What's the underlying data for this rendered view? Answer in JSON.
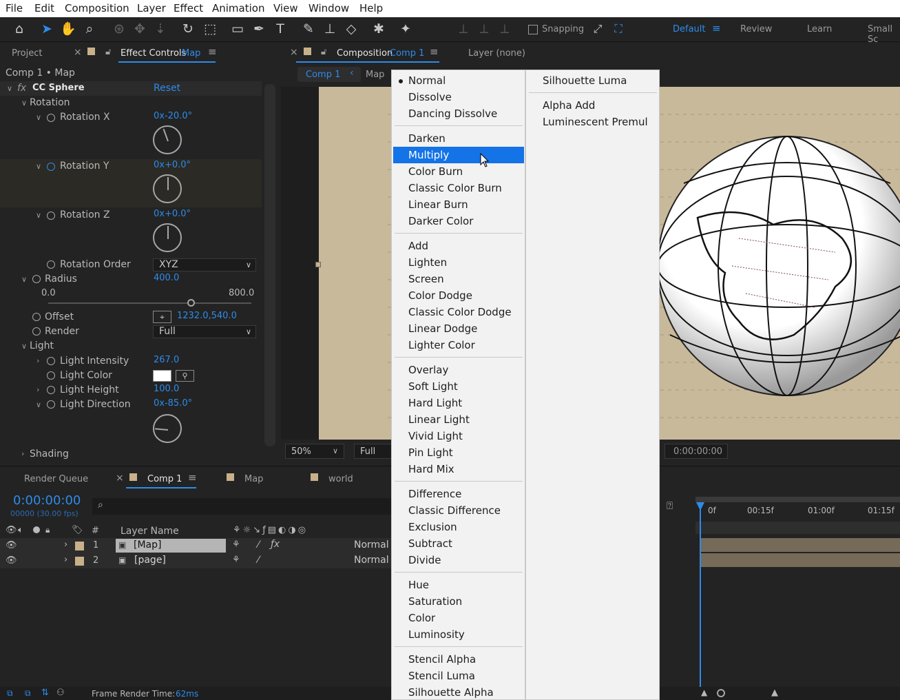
{
  "menubar": {
    "items": [
      "File",
      "Edit",
      "Composition",
      "Layer",
      "Effect",
      "Animation",
      "View",
      "Window",
      "Help"
    ]
  },
  "toolbar": {
    "snapping_label": "Snapping",
    "workspaces": [
      "Default",
      "Review",
      "Learn",
      "Small Sc"
    ],
    "active_workspace": "Default"
  },
  "left_panel": {
    "tab_project": "Project",
    "tab_effect_controls": "Effect Controls",
    "tab_effect_controls_target": "Map",
    "breadcrumb": "Comp 1 • Map",
    "effect_badge": "fx",
    "effect_name": "CC Sphere",
    "reset_label": "Reset",
    "rotation_group": "Rotation",
    "rotation_x_label": "Rotation X",
    "rotation_x_value": "0x-20.0°",
    "rotation_y_label": "Rotation Y",
    "rotation_y_value": "0x+0.0°",
    "rotation_z_label": "Rotation Z",
    "rotation_z_value": "0x+0.0°",
    "rotation_order_label": "Rotation Order",
    "rotation_order_value": "XYZ",
    "radius_label": "Radius",
    "radius_value": "400.0",
    "radius_min": "0.0",
    "radius_max": "800.0",
    "radius_fraction": 0.5,
    "offset_label": "Offset",
    "offset_value": "1232.0,540.0",
    "render_label": "Render",
    "render_value": "Full",
    "light_group": "Light",
    "light_intensity_label": "Light Intensity",
    "light_intensity_value": "267.0",
    "light_color_label": "Light Color",
    "light_height_label": "Light Height",
    "light_height_value": "100.0",
    "light_direction_label": "Light Direction",
    "light_direction_value": "0x-85.0°",
    "shading_group": "Shading"
  },
  "comp_panel": {
    "tab_label": "Composition",
    "tab_target": "Comp 1",
    "layer_tab": "Layer (none)",
    "breadcrumb_comp": "Comp 1",
    "breadcrumb_map": "Map",
    "zoom": "50%",
    "resolution": "Full",
    "timecode": "0:00:00:00"
  },
  "blend_menu": {
    "col1_groups": [
      [
        "Normal",
        "Dissolve",
        "Dancing Dissolve"
      ],
      [
        "Darken",
        "Multiply",
        "Color Burn",
        "Classic Color Burn",
        "Linear Burn",
        "Darker Color"
      ],
      [
        "Add",
        "Lighten",
        "Screen",
        "Color Dodge",
        "Classic Color Dodge",
        "Linear Dodge",
        "Lighter Color"
      ],
      [
        "Overlay",
        "Soft Light",
        "Hard Light",
        "Linear Light",
        "Vivid Light",
        "Pin Light",
        "Hard Mix"
      ],
      [
        "Difference",
        "Classic Difference",
        "Exclusion",
        "Subtract",
        "Divide"
      ],
      [
        "Hue",
        "Saturation",
        "Color",
        "Luminosity"
      ],
      [
        "Stencil Alpha",
        "Stencil Luma",
        "Silhouette Alpha"
      ]
    ],
    "col2_groups": [
      [
        "Silhouette Luma"
      ],
      [
        "Alpha Add",
        "Luminescent Premul"
      ]
    ],
    "current": "Normal",
    "highlighted": "Multiply"
  },
  "timeline": {
    "tab_render_queue": "Render Queue",
    "tab_comp1": "Comp 1",
    "tab_map": "Map",
    "tab_world": "world",
    "timecode": "0:00:00:00",
    "frame_info": "00000 (30.00 fps)",
    "col_hash": "#",
    "col_layer_name": "Layer Name",
    "layers": [
      {
        "num": "1",
        "name": "[Map]",
        "mode": "Normal"
      },
      {
        "num": "2",
        "name": "[page]",
        "mode": "Normal"
      }
    ],
    "ruler": [
      "0f",
      "00:15f",
      "01:00f",
      "01:15f"
    ],
    "frame_render_label": "Frame Render Time:",
    "frame_render_value": "62ms"
  },
  "colors": {
    "accent": "#2d8ceb",
    "menu_highlight": "#1473e6",
    "panel_bg": "#232323",
    "comp_bg": "#c8b89a"
  }
}
